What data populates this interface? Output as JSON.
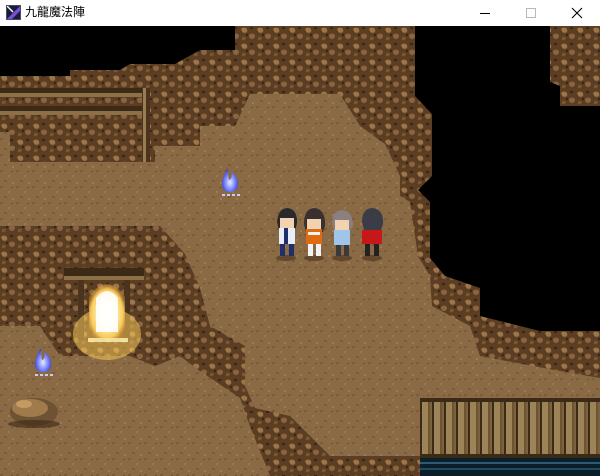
{
  "window": {
    "title": "九龍魔法陣",
    "icon": "game-app-icon",
    "controls": [
      "minimize-icon",
      "maximize-icon",
      "close-icon"
    ]
  },
  "scene": {
    "location": "cave",
    "party": [
      {
        "id": "hero-1",
        "hair": "#2a2a2a",
        "outfit": "#e8eef8",
        "accent": "#1f2f6b"
      },
      {
        "id": "hero-2",
        "hair": "#3a3030",
        "outfit": "#e06a10",
        "accent": "#f2f2f2"
      },
      {
        "id": "hero-3",
        "hair": "#8a8080",
        "outfit": "#9fc6e8",
        "accent": "#3a3a3a"
      },
      {
        "id": "hero-4",
        "hair": "#3c3c48",
        "outfit": "#c61818",
        "accent": "#222222"
      }
    ],
    "objects": [
      "blue-spirit-flame",
      "blue-spirit-flame",
      "glowing-doorway",
      "wooden-bridge",
      "wooden-fence",
      "boulder"
    ],
    "colors": {
      "floor": "#8a6a44",
      "rock": "#5a3d22",
      "rock_light": "#9c7648",
      "void": "#000000",
      "glow": "#fff3b0",
      "spirit": "#5b6cff"
    }
  }
}
